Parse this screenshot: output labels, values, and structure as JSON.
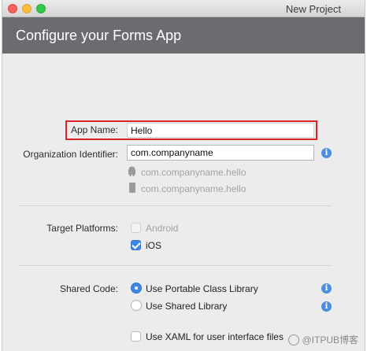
{
  "window": {
    "title": "New Project"
  },
  "header": {
    "title": "Configure your Forms App"
  },
  "form": {
    "app_name": {
      "label": "App Name:",
      "value": "Hello"
    },
    "org_id": {
      "label": "Organization Identifier:",
      "value": "com.companyname"
    },
    "bundle_android": "com.companyname.hello",
    "bundle_ios": "com.companyname.hello",
    "target_platforms": {
      "label": "Target Platforms:",
      "android": {
        "label": "Android",
        "checked": false,
        "disabled": true
      },
      "ios": {
        "label": "iOS",
        "checked": true
      }
    },
    "shared_code": {
      "label": "Shared Code:",
      "portable": {
        "label": "Use Portable Class Library",
        "selected": true
      },
      "shared": {
        "label": "Use Shared Library",
        "selected": false
      }
    },
    "xaml": {
      "label": "Use XAML for user interface files",
      "checked": false
    }
  },
  "icons": {
    "info": "i",
    "accent": "#4b8fdd",
    "highlight_color": "#d9242a"
  },
  "watermark": {
    "text": "@ITPUB博客"
  }
}
